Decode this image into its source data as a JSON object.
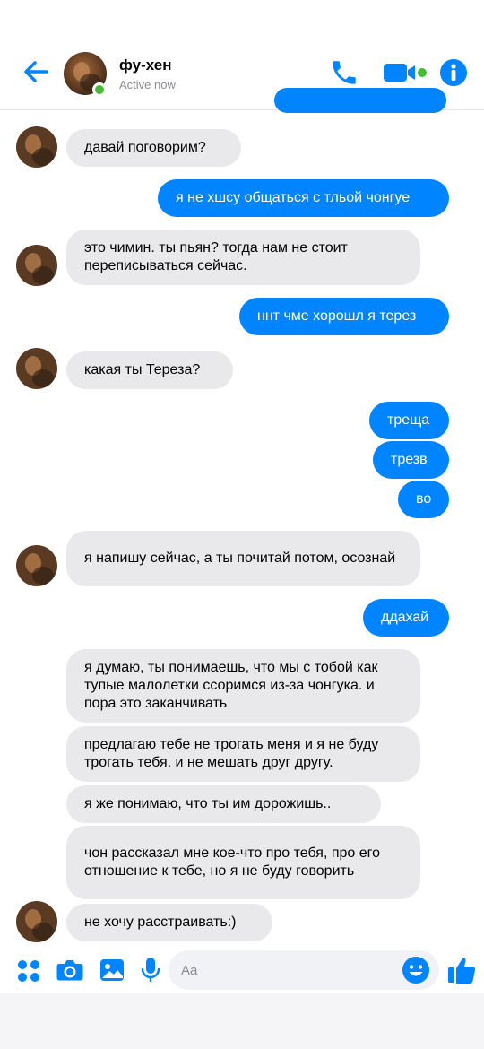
{
  "header": {
    "contact_name": "фу-хен",
    "status": "Active now"
  },
  "colors": {
    "accent": "#0084ff",
    "incoming_bubble": "#e9e9eb",
    "online": "#44bd32"
  },
  "messages": [
    {
      "dir": "in",
      "text": "давай поговорим?"
    },
    {
      "dir": "out",
      "text": "я не хшсу общаться с тльой чонгуе"
    },
    {
      "dir": "in",
      "text": "это чимин. ты пьян? тогда нам не стоит переписываться сейчас."
    },
    {
      "dir": "out",
      "text": "ннт чме хорошл я терез"
    },
    {
      "dir": "in",
      "text": "какая ты Тереза?"
    },
    {
      "dir": "out",
      "text": "треща"
    },
    {
      "dir": "out",
      "text": "трезв"
    },
    {
      "dir": "out",
      "text": "во"
    },
    {
      "dir": "in",
      "text": "я напишу сейчас, а ты почитай потом, осознай"
    },
    {
      "dir": "out",
      "text": "ддахай"
    },
    {
      "dir": "in",
      "text": "я думаю, ты понимаешь, что мы с тобой как тупые малолетки ссоримся из-за чонгука. и пора это заканчивать"
    },
    {
      "dir": "in",
      "text": "предлагаю тебе не трогать меня и я не буду трогать тебя. и не мешать друг другу."
    },
    {
      "dir": "in",
      "text": "я же понимаю, что ты им дорожишь.."
    },
    {
      "dir": "in",
      "text": "чон рассказал мне кое-что про тебя, про его отношение к тебе, но я не буду говорить"
    },
    {
      "dir": "in",
      "text": "не хочу расстраивать:)"
    }
  ],
  "composer": {
    "placeholder": "Aa",
    "icons": [
      "menu-dots-icon",
      "camera-icon",
      "image-icon",
      "microphone-icon",
      "emoji-icon",
      "thumbs-up-icon"
    ]
  }
}
